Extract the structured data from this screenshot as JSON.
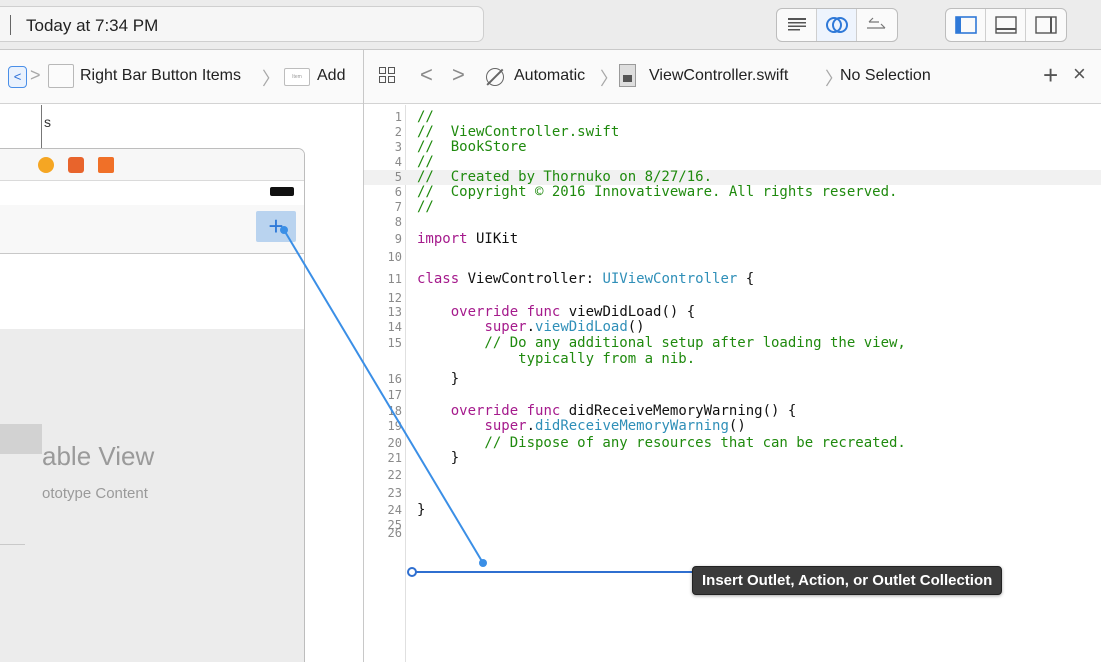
{
  "activity": {
    "status_text": "Today at 7:34 PM"
  },
  "toolbar": {
    "editor_buttons": [
      {
        "icon": "standard-editor-icon"
      },
      {
        "icon": "assistant-editor-icon"
      },
      {
        "icon": "version-editor-icon"
      }
    ],
    "view_buttons": [
      {
        "icon": "navigator-toggle-icon"
      },
      {
        "icon": "debug-area-toggle-icon"
      },
      {
        "icon": "utilities-toggle-icon"
      }
    ]
  },
  "storyboard_jump_bar": {
    "back": "<",
    "forward": ">",
    "crumbs": [
      "Right Bar Button Items",
      "Add"
    ],
    "item_icon_text": "Item"
  },
  "storyboard": {
    "add_button_symbol": "+",
    "cell_label_fragment": "s",
    "table_view_title": "able View",
    "table_view_subtitle": "ototype Content"
  },
  "editor_jump_bar": {
    "back": "<",
    "forward": ">",
    "mode": "Automatic",
    "file": "ViewController.swift",
    "selection": "No Selection",
    "add_symbol": "+",
    "close_symbol": "×"
  },
  "code": {
    "highlighted_line": 5,
    "lines": [
      {
        "n": "1",
        "parts": [
          {
            "t": "//",
            "c": "comment"
          }
        ]
      },
      {
        "n": "2",
        "parts": [
          {
            "t": "//  ViewController.swift",
            "c": "comment"
          }
        ]
      },
      {
        "n": "3",
        "parts": [
          {
            "t": "//  BookStore",
            "c": "comment"
          }
        ]
      },
      {
        "n": "4",
        "parts": [
          {
            "t": "//",
            "c": "comment"
          }
        ]
      },
      {
        "n": "5",
        "parts": [
          {
            "t": "//  Created by Thornuko on 8/27/16.",
            "c": "comment"
          }
        ]
      },
      {
        "n": "6",
        "parts": [
          {
            "t": "//  Copyright © 2016 Innovativeware. All rights reserved.",
            "c": "comment"
          }
        ]
      },
      {
        "n": "7",
        "parts": [
          {
            "t": "//",
            "c": "comment"
          }
        ]
      },
      {
        "n": "8",
        "parts": []
      },
      {
        "n": "9",
        "parts": [
          {
            "t": "import",
            "c": "kw"
          },
          {
            "t": " UIKit",
            "c": "plain"
          }
        ]
      },
      {
        "n": "10",
        "parts": []
      },
      {
        "n": "11",
        "parts": [
          {
            "t": "class",
            "c": "kw"
          },
          {
            "t": " ViewController: ",
            "c": "plain"
          },
          {
            "t": "UIViewController",
            "c": "type"
          },
          {
            "t": " {",
            "c": "plain"
          }
        ]
      },
      {
        "n": "12",
        "parts": []
      },
      {
        "n": "13",
        "parts": [
          {
            "t": "    ",
            "c": "plain"
          },
          {
            "t": "override",
            "c": "kw"
          },
          {
            "t": " ",
            "c": "plain"
          },
          {
            "t": "func",
            "c": "kw"
          },
          {
            "t": " viewDidLoad() {",
            "c": "plain"
          }
        ]
      },
      {
        "n": "14",
        "parts": [
          {
            "t": "        ",
            "c": "plain"
          },
          {
            "t": "super",
            "c": "kw"
          },
          {
            "t": ".",
            "c": "plain"
          },
          {
            "t": "viewDidLoad",
            "c": "type"
          },
          {
            "t": "()",
            "c": "plain"
          }
        ]
      },
      {
        "n": "15",
        "parts": [
          {
            "t": "        // Do any additional setup after loading the view,",
            "c": "comment"
          }
        ]
      },
      {
        "n": "",
        "parts": [
          {
            "t": "            typically from a nib.",
            "c": "comment"
          }
        ]
      },
      {
        "n": "16",
        "parts": [
          {
            "t": "    }",
            "c": "plain"
          }
        ]
      },
      {
        "n": "17",
        "parts": []
      },
      {
        "n": "18",
        "parts": [
          {
            "t": "    ",
            "c": "plain"
          },
          {
            "t": "override",
            "c": "kw"
          },
          {
            "t": " ",
            "c": "plain"
          },
          {
            "t": "func",
            "c": "kw"
          },
          {
            "t": " didReceiveMemoryWarning() {",
            "c": "plain"
          }
        ]
      },
      {
        "n": "19",
        "parts": [
          {
            "t": "        ",
            "c": "plain"
          },
          {
            "t": "super",
            "c": "kw"
          },
          {
            "t": ".",
            "c": "plain"
          },
          {
            "t": "didReceiveMemoryWarning",
            "c": "type"
          },
          {
            "t": "()",
            "c": "plain"
          }
        ]
      },
      {
        "n": "20",
        "parts": [
          {
            "t": "        // Dispose of any resources that can be recreated.",
            "c": "comment"
          }
        ]
      },
      {
        "n": "21",
        "parts": [
          {
            "t": "    }",
            "c": "plain"
          }
        ]
      },
      {
        "n": "22",
        "parts": []
      },
      {
        "n": "23",
        "parts": []
      },
      {
        "n": "24",
        "parts": [
          {
            "t": "}",
            "c": "plain"
          }
        ]
      },
      {
        "n": "25",
        "parts": []
      },
      {
        "n": "26",
        "parts": []
      }
    ]
  },
  "connection": {
    "tooltip": "Insert Outlet, Action, or Outlet Collection",
    "line_color": "#3b8fe6",
    "insertion_color": "#2f6fd0"
  },
  "colors": {
    "comment": "#1f8a0e",
    "keyword": "#a51a8c",
    "type": "#2f8fb8",
    "accent": "#2f79d8"
  }
}
